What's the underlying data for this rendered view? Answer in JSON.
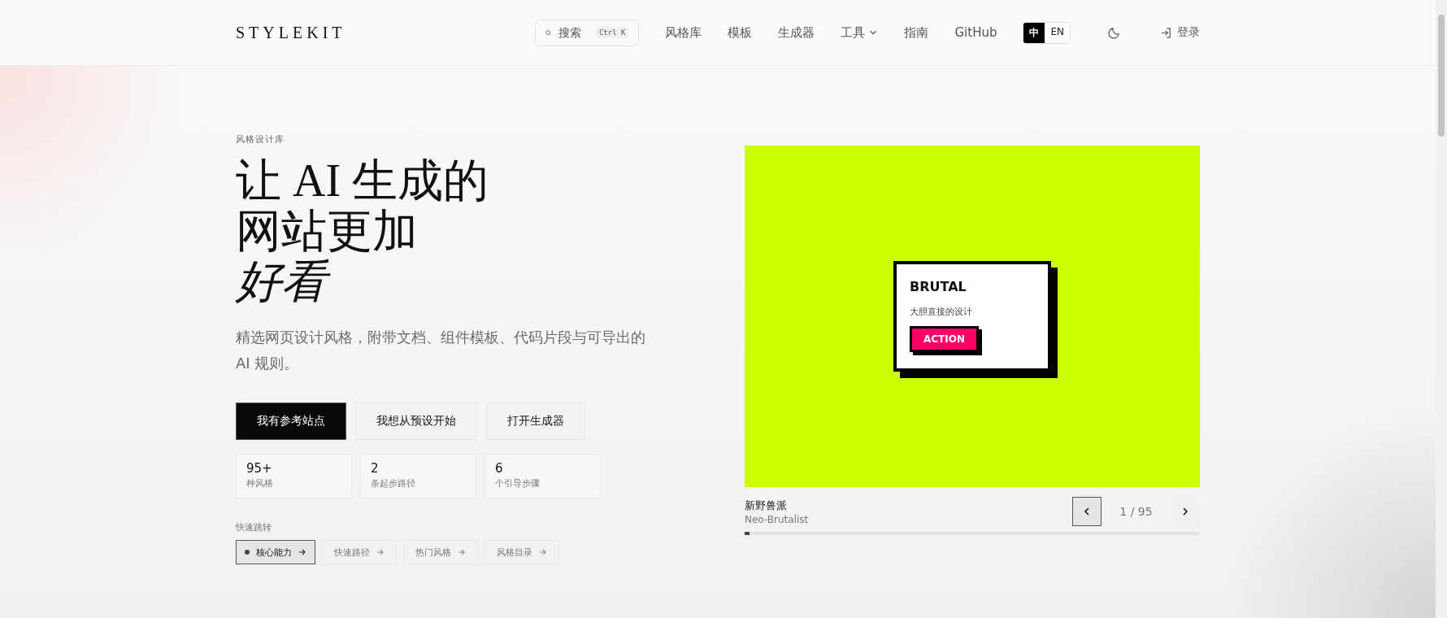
{
  "header": {
    "logo": "STYLEKIT",
    "search": {
      "placeholder": "搜索",
      "shortcut": "Ctrl K"
    },
    "nav": [
      {
        "label": "风格库",
        "kind": "link"
      },
      {
        "label": "模板",
        "kind": "link"
      },
      {
        "label": "生成器",
        "kind": "link"
      },
      {
        "label": "工具",
        "kind": "dropdown"
      },
      {
        "label": "指南",
        "kind": "link"
      },
      {
        "label": "GitHub",
        "kind": "link"
      }
    ],
    "languages": [
      {
        "label": "中",
        "selected": true
      },
      {
        "label": "EN",
        "selected": false
      }
    ],
    "login": "登录"
  },
  "hero": {
    "eyebrow": "风格设计库",
    "title_lines": [
      {
        "text": "让 AI 生成的",
        "italic": false
      },
      {
        "text": "网站更加",
        "italic": false
      },
      {
        "text": "好看",
        "italic": true
      }
    ],
    "subtitle": "精选网页设计风格，附带文档、组件模板、代码片段与可导出的 AI 规则。",
    "buttons": [
      {
        "label": "我有参考站点",
        "primary": true
      },
      {
        "label": "我想从预设开始",
        "primary": false
      },
      {
        "label": "打开生成器",
        "primary": false
      }
    ],
    "stats": [
      {
        "value": "95+",
        "label": "种风格"
      },
      {
        "value": "2",
        "label": "条起步路径"
      },
      {
        "value": "6",
        "label": "个引导步骤"
      }
    ],
    "quick_jump": {
      "label": "快速跳转",
      "chips": [
        {
          "label": "核心能力",
          "selected": true
        },
        {
          "label": "快速路径",
          "selected": false
        },
        {
          "label": "热门风格",
          "selected": false
        },
        {
          "label": "风格目录",
          "selected": false
        }
      ]
    }
  },
  "preview": {
    "card": {
      "title": "BRUTAL",
      "text": "大胆直接的设计",
      "button": "ACTION"
    },
    "name": "新野兽派",
    "subtitle": "Neo-Brutalist",
    "counter": "1 / 95",
    "level": 0.0105
  }
}
